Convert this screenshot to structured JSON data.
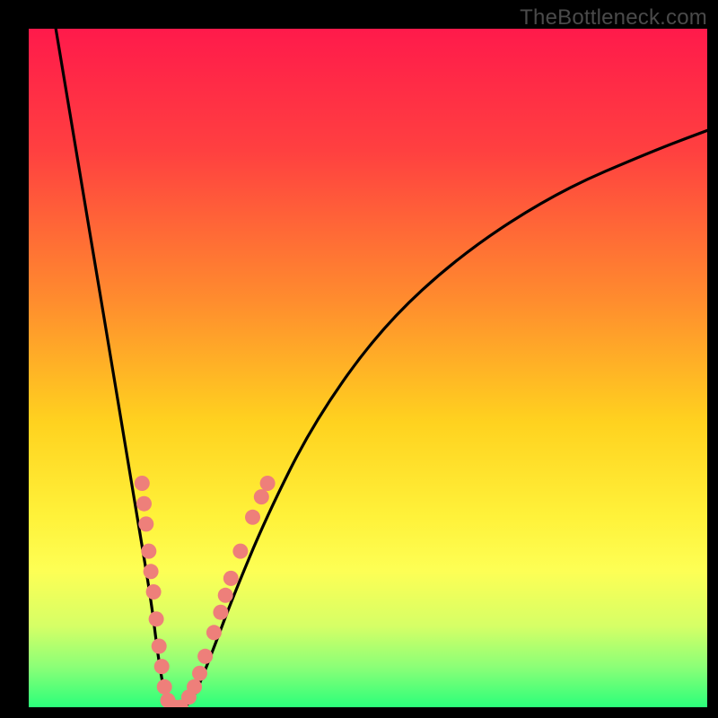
{
  "watermark": "TheBottleneck.com",
  "chart_data": {
    "type": "line",
    "title": "",
    "xlabel": "",
    "ylabel": "",
    "xlim": [
      0,
      100
    ],
    "ylim": [
      0,
      100
    ],
    "gradient_stops": [
      {
        "offset": 0,
        "color": "#ff1a4b"
      },
      {
        "offset": 18,
        "color": "#ff4040"
      },
      {
        "offset": 40,
        "color": "#ff8c2e"
      },
      {
        "offset": 58,
        "color": "#ffd21f"
      },
      {
        "offset": 72,
        "color": "#fff23a"
      },
      {
        "offset": 80,
        "color": "#fdff55"
      },
      {
        "offset": 88,
        "color": "#d6ff66"
      },
      {
        "offset": 94,
        "color": "#8cff77"
      },
      {
        "offset": 100,
        "color": "#2bff7a"
      }
    ],
    "series": [
      {
        "name": "left-branch",
        "x": [
          4,
          6,
          8,
          10,
          12,
          14,
          16,
          18,
          19,
          19.8,
          20.5,
          21
        ],
        "y": [
          100,
          88,
          76,
          64,
          52,
          40,
          28,
          16,
          8,
          3,
          0.8,
          0
        ]
      },
      {
        "name": "right-branch",
        "x": [
          23,
          24,
          25,
          27,
          30,
          35,
          42,
          52,
          64,
          78,
          92,
          100
        ],
        "y": [
          0,
          1,
          3,
          8,
          16,
          28,
          42,
          56,
          67,
          76,
          82,
          85
        ]
      }
    ],
    "highlight_points": {
      "color": "#ee7f7a",
      "points": [
        {
          "branch": "left",
          "x": 16.7,
          "y": 33
        },
        {
          "branch": "left",
          "x": 17.0,
          "y": 30
        },
        {
          "branch": "left",
          "x": 17.3,
          "y": 27
        },
        {
          "branch": "left",
          "x": 17.7,
          "y": 23
        },
        {
          "branch": "left",
          "x": 18.0,
          "y": 20
        },
        {
          "branch": "left",
          "x": 18.4,
          "y": 17
        },
        {
          "branch": "left",
          "x": 18.8,
          "y": 13
        },
        {
          "branch": "left",
          "x": 19.2,
          "y": 9
        },
        {
          "branch": "left",
          "x": 19.6,
          "y": 6
        },
        {
          "branch": "left",
          "x": 20.0,
          "y": 3
        },
        {
          "branch": "left",
          "x": 20.5,
          "y": 1
        },
        {
          "branch": "right",
          "x": 21.5,
          "y": 0
        },
        {
          "branch": "right",
          "x": 22.4,
          "y": 0
        },
        {
          "branch": "right",
          "x": 23.6,
          "y": 1.5
        },
        {
          "branch": "right",
          "x": 24.4,
          "y": 3
        },
        {
          "branch": "right",
          "x": 25.2,
          "y": 5
        },
        {
          "branch": "right",
          "x": 26.0,
          "y": 7.5
        },
        {
          "branch": "right",
          "x": 27.3,
          "y": 11
        },
        {
          "branch": "right",
          "x": 28.3,
          "y": 14
        },
        {
          "branch": "right",
          "x": 29.0,
          "y": 16.5
        },
        {
          "branch": "right",
          "x": 29.8,
          "y": 19
        },
        {
          "branch": "right",
          "x": 31.2,
          "y": 23
        },
        {
          "branch": "right",
          "x": 33.0,
          "y": 28
        },
        {
          "branch": "right",
          "x": 34.3,
          "y": 31
        },
        {
          "branch": "right",
          "x": 35.2,
          "y": 33
        }
      ]
    }
  }
}
